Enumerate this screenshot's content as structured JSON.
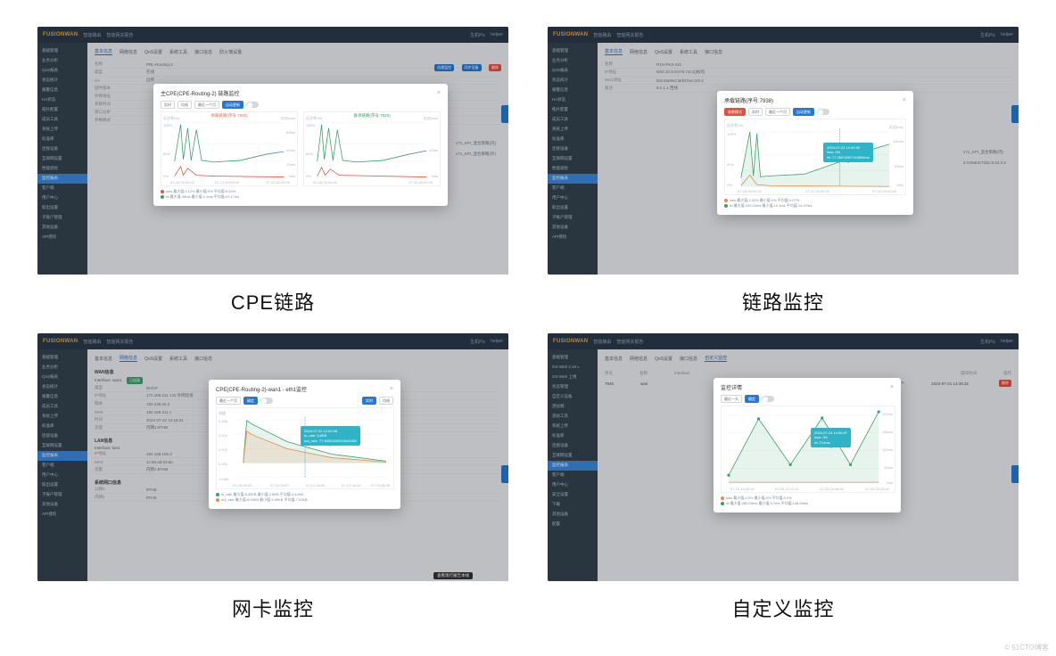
{
  "brand": "FUSIONWAN",
  "topnav": [
    "智能路由",
    "智能网关报告"
  ],
  "topright": [
    "生机Pic",
    "helper"
  ],
  "captions": {
    "tl": "CPE链路",
    "tr": "链路监控",
    "bl": "网卡监控",
    "br": "自定义监控"
  },
  "sidebar": {
    "items": [
      "基础管理",
      "业务分析",
      "QoS报表",
      "状态统计",
      "报警信息",
      "HA状态",
      "拓扑配置",
      "成员工具",
      "系统上传",
      "标准库",
      "连接设备",
      "互联网设置",
      "性能调优",
      "监控报表",
      "客户端",
      "用户中心",
      "取出设置",
      "子账户管理",
      "其他设备",
      "API授权",
      "安全设置",
      "下载",
      "配置"
    ],
    "active_index": 13
  },
  "tabs": [
    "基本信息",
    "网络信息",
    "QoS设置",
    "系统工具",
    "接口信息",
    "防火墙设置",
    "自定义监控"
  ],
  "rows_left": [
    [
      "名称",
      "PRL-Routing-2"
    ],
    [
      "类型",
      "在线",
      "green"
    ],
    [
      "HA",
      "启用",
      "blue"
    ],
    [
      "固件版本",
      ""
    ],
    [
      "外网地址",
      ""
    ],
    [
      "系统时间",
      ""
    ],
    [
      "接口分析",
      ""
    ],
    [
      "参数模式",
      ""
    ]
  ],
  "right_actions": [
    "创建监控",
    "同步设备",
    "删除"
  ],
  "right_list": [
    "171_KPI_混合策略(内)",
    "171_KPI_混合策略(外)"
  ],
  "modal_tl": {
    "title": "主CPE(CPE-Routing-2) 链路监控",
    "pills": [
      "实时",
      "均线"
    ],
    "range": "最近一个月",
    "btn": "自动更新",
    "chart_a_title": "承载链路(序号:7920)",
    "chart_b_title": "备承链路(序号:7920)",
    "ytick": [
      "反应率(%)",
      "100%",
      "60%",
      "0%"
    ],
    "rtick": [
      "反应(ms)",
      "60ms",
      "40ms",
      "20ms",
      "0ms"
    ],
    "xtick": [
      "07-16 00:00:00",
      "07-19 00:00:00",
      "07-21 00:00:00",
      "07-22 00:00:00"
    ],
    "legend": [
      "loss  最大值:0.12%  最小值:0%  平均值:0.02%",
      "rtt   最大值:35ms  最小值:2.1ms  平均值:20.17ms"
    ]
  },
  "modal_tr": {
    "title": "承载链路(序号:7938)",
    "pills": [
      "实时",
      "均线"
    ],
    "range": "最近一个月",
    "btn": "自动更新",
    "subpill": "参数模式",
    "ytick": [
      "反应率(%)",
      "100%",
      "60%",
      "0%"
    ],
    "rtick": [
      "反应(ms)",
      "100ms",
      "40ms",
      "0ms"
    ],
    "xtick": [
      "07-18 00:00:00",
      "07-21 00:00:00",
      "07-22 00:00:00"
    ],
    "tooltip": [
      "2024-07-22 10:40:00",
      "loss: 0%",
      "rtt: 77.28074807143596ms"
    ],
    "legend": [
      "loss  最大值:1.92%  最小值:0%  平均值:0.07%",
      "rtt   最大值:100.24ms  最小值:12.1ms  平均值:14.37ms"
    ],
    "rows": [
      [
        "名称",
        "R1N-PK3-410"
      ],
      [
        "IP地址",
        "9/20.10.9.5/476;74c1(关闭)"
      ],
      [
        "MAC地址",
        "link:5tat9eClarksTwo:1/0.2"
      ],
      [
        "备注",
        "8.2.1.1 西线"
      ]
    ]
  },
  "rows_tr_side": [
    [
      "别名",
      "171_KPI_混合策略(内)"
    ],
    [
      "MAC",
      "3.N:5tat3cTd3c:5:43.3-2"
    ]
  ],
  "modal_bl": {
    "title": "CPE(CPE-Routing-2)-wan1 - eth1监控",
    "range": "最近一个月",
    "btn": "确定",
    "pills": [
      "实时",
      "均线"
    ],
    "ylabel": "流量",
    "ytick": [
      "0.006",
      "0.004",
      "0.002",
      "0.000",
      "-0.006"
    ],
    "xtick": [
      "07-18 00:00",
      "07-20 09:07",
      "07-21 08:05",
      "07-22 08:23",
      "07-23 08:58"
    ],
    "tooltip": [
      "2024-07-22 12:00:05",
      "in_rate: 5.8KB",
      "out_rate: 77.84324000026425KB"
    ],
    "legend": [
      "in_rate   最大值:8.32KB  最小值:2.8KB  平均值:4.42KB",
      "out_rate  最大值:8.04KB  最小值:3.95KB  平均值:7.02KB"
    ]
  },
  "left_panel_bl": {
    "title_wan": "WAN信息",
    "iface": "Interface: wan1",
    "badge": "已连接",
    "rows": [
      [
        "类型",
        "DHCP"
      ],
      [
        "IP地址",
        "172.168.211.133  外网连接"
      ],
      [
        "网关",
        "192.235.25.3"
      ],
      [
        "DNS",
        "192.168.211.1"
      ],
      [
        "时间",
        "2024-07-22 12:16:31"
      ],
      [
        "流量",
        "内网1:8THB"
      ]
    ],
    "title_lan": "LAN信息",
    "iface2": "Interface: lan1",
    "rows2": [
      [
        "IP地址",
        "192.168.100.3"
      ],
      [
        "MAC",
        "1c:86:ad:03:8e"
      ],
      [
        "流量",
        "内网1:8THB"
      ]
    ],
    "nic_title": "系统网口信息",
    "nic_rows": [
      [
        "公网0",
        "8THB"
      ],
      [
        "内网1",
        "8THB"
      ]
    ]
  },
  "modal_br": {
    "title": "监控详情",
    "range": "最近一天",
    "btn": "确定",
    "rtick": [
      "200ms",
      "150ms",
      "100ms",
      "50ms",
      "0ms"
    ],
    "xtick": [
      "07-24 14:30:51",
      "07-24 15:12:01",
      "07-24 15:48:51",
      "07-24 16:25:42"
    ],
    "tooltip": [
      "2024-07-24 14:56:07",
      "loss: 0%",
      "rtt: 214ms"
    ],
    "legend": [
      "loss  最大值:0.0%  最小值:0%  平均值:0.0%",
      "rtt   最大值:280.00ms  最小值:5.7ms  平均值:148.00ms"
    ]
  },
  "table_br": {
    "head": [
      "序号",
      "名称",
      "Interface",
      "",
      "操作时间",
      "操作"
    ],
    "row": [
      "7936",
      "wan",
      "",
      "",
      "2024-07-21 14:48:32",
      "删除"
    ]
  },
  "sidebar_br_extra": [
    "GS-Web 2.15 v",
    "GS-Web 上线",
    "状态管理",
    "自定义设备",
    "测试端",
    "测试工具"
  ],
  "tag_black": "查看现行报告本线",
  "watermark": "© 51CTO博客",
  "chart_data": [
    {
      "id": "tl-left",
      "type": "line",
      "y_left_pct": [
        0,
        100
      ],
      "y_right_ms": [
        0,
        60
      ],
      "series": [
        {
          "name": "rtt",
          "axis": "right",
          "color": "#3aa06a",
          "x": [
            0,
            5,
            7,
            8,
            10,
            12,
            14,
            16,
            30,
            50,
            70,
            90,
            100
          ],
          "y": [
            15,
            55,
            18,
            52,
            17,
            48,
            16,
            15,
            14,
            15,
            20,
            25,
            27
          ]
        },
        {
          "name": "loss",
          "axis": "left",
          "color": "#d95b4a",
          "x": [
            0,
            5,
            8,
            12,
            20,
            40,
            100
          ],
          "y": [
            0,
            12,
            2,
            10,
            3,
            2,
            0
          ]
        }
      ]
    },
    {
      "id": "tl-right",
      "type": "line",
      "y_left_pct": [
        0,
        100
      ],
      "y_right_ms": [
        0,
        60
      ],
      "series": [
        {
          "name": "rtt",
          "axis": "right",
          "color": "#3aa06a",
          "x": [
            0,
            4,
            5,
            8,
            10,
            14,
            18,
            30,
            50,
            70,
            90,
            100
          ],
          "y": [
            16,
            55,
            18,
            50,
            18,
            48,
            15,
            14,
            15,
            20,
            25,
            28
          ]
        },
        {
          "name": "loss",
          "axis": "left",
          "color": "#d95b4a",
          "x": [
            0,
            5,
            8,
            12,
            20,
            40,
            100
          ],
          "y": [
            0,
            10,
            3,
            9,
            3,
            2,
            0
          ]
        }
      ]
    },
    {
      "id": "tr",
      "type": "line",
      "y_left_pct": [
        0,
        100
      ],
      "y_right_ms": [
        0,
        100
      ],
      "series": [
        {
          "name": "rtt",
          "axis": "right",
          "color": "#3aa06a",
          "x": [
            0,
            8,
            10,
            12,
            15,
            22,
            40,
            60,
            80,
            100
          ],
          "y": [
            12,
            100,
            15,
            98,
            14,
            13,
            15,
            30,
            55,
            77
          ]
        },
        {
          "name": "loss",
          "axis": "left",
          "color": "#e58a4c",
          "x": [
            0,
            8,
            12,
            20,
            100
          ],
          "y": [
            0,
            12,
            4,
            2,
            1
          ]
        }
      ]
    },
    {
      "id": "bl",
      "type": "area",
      "ylim": [
        -0.006,
        0.006
      ],
      "series": [
        {
          "name": "in_rate",
          "color": "#3aa06a",
          "x": [
            0,
            5,
            10,
            30,
            60,
            100
          ],
          "y": [
            0,
            0.008,
            0.007,
            0.005,
            0.003,
            0.001
          ]
        },
        {
          "name": "out_rate",
          "color": "#e58a4c",
          "x": [
            0,
            5,
            10,
            30,
            60,
            100
          ],
          "y": [
            0,
            0.006,
            0.005,
            0.003,
            0.002,
            0.0005
          ]
        }
      ]
    },
    {
      "id": "br",
      "type": "line",
      "y_right_ms": [
        0,
        250
      ],
      "series": [
        {
          "name": "rtt",
          "axis": "right",
          "color": "#3aa06a",
          "x": [
            0,
            20,
            40,
            60,
            80,
            100
          ],
          "y": [
            30,
            210,
            60,
            214,
            55,
            230
          ]
        },
        {
          "name": "loss",
          "axis": "left",
          "color": "#e58a4c",
          "x": [
            0,
            100
          ],
          "y": [
            0,
            0
          ]
        }
      ]
    }
  ]
}
